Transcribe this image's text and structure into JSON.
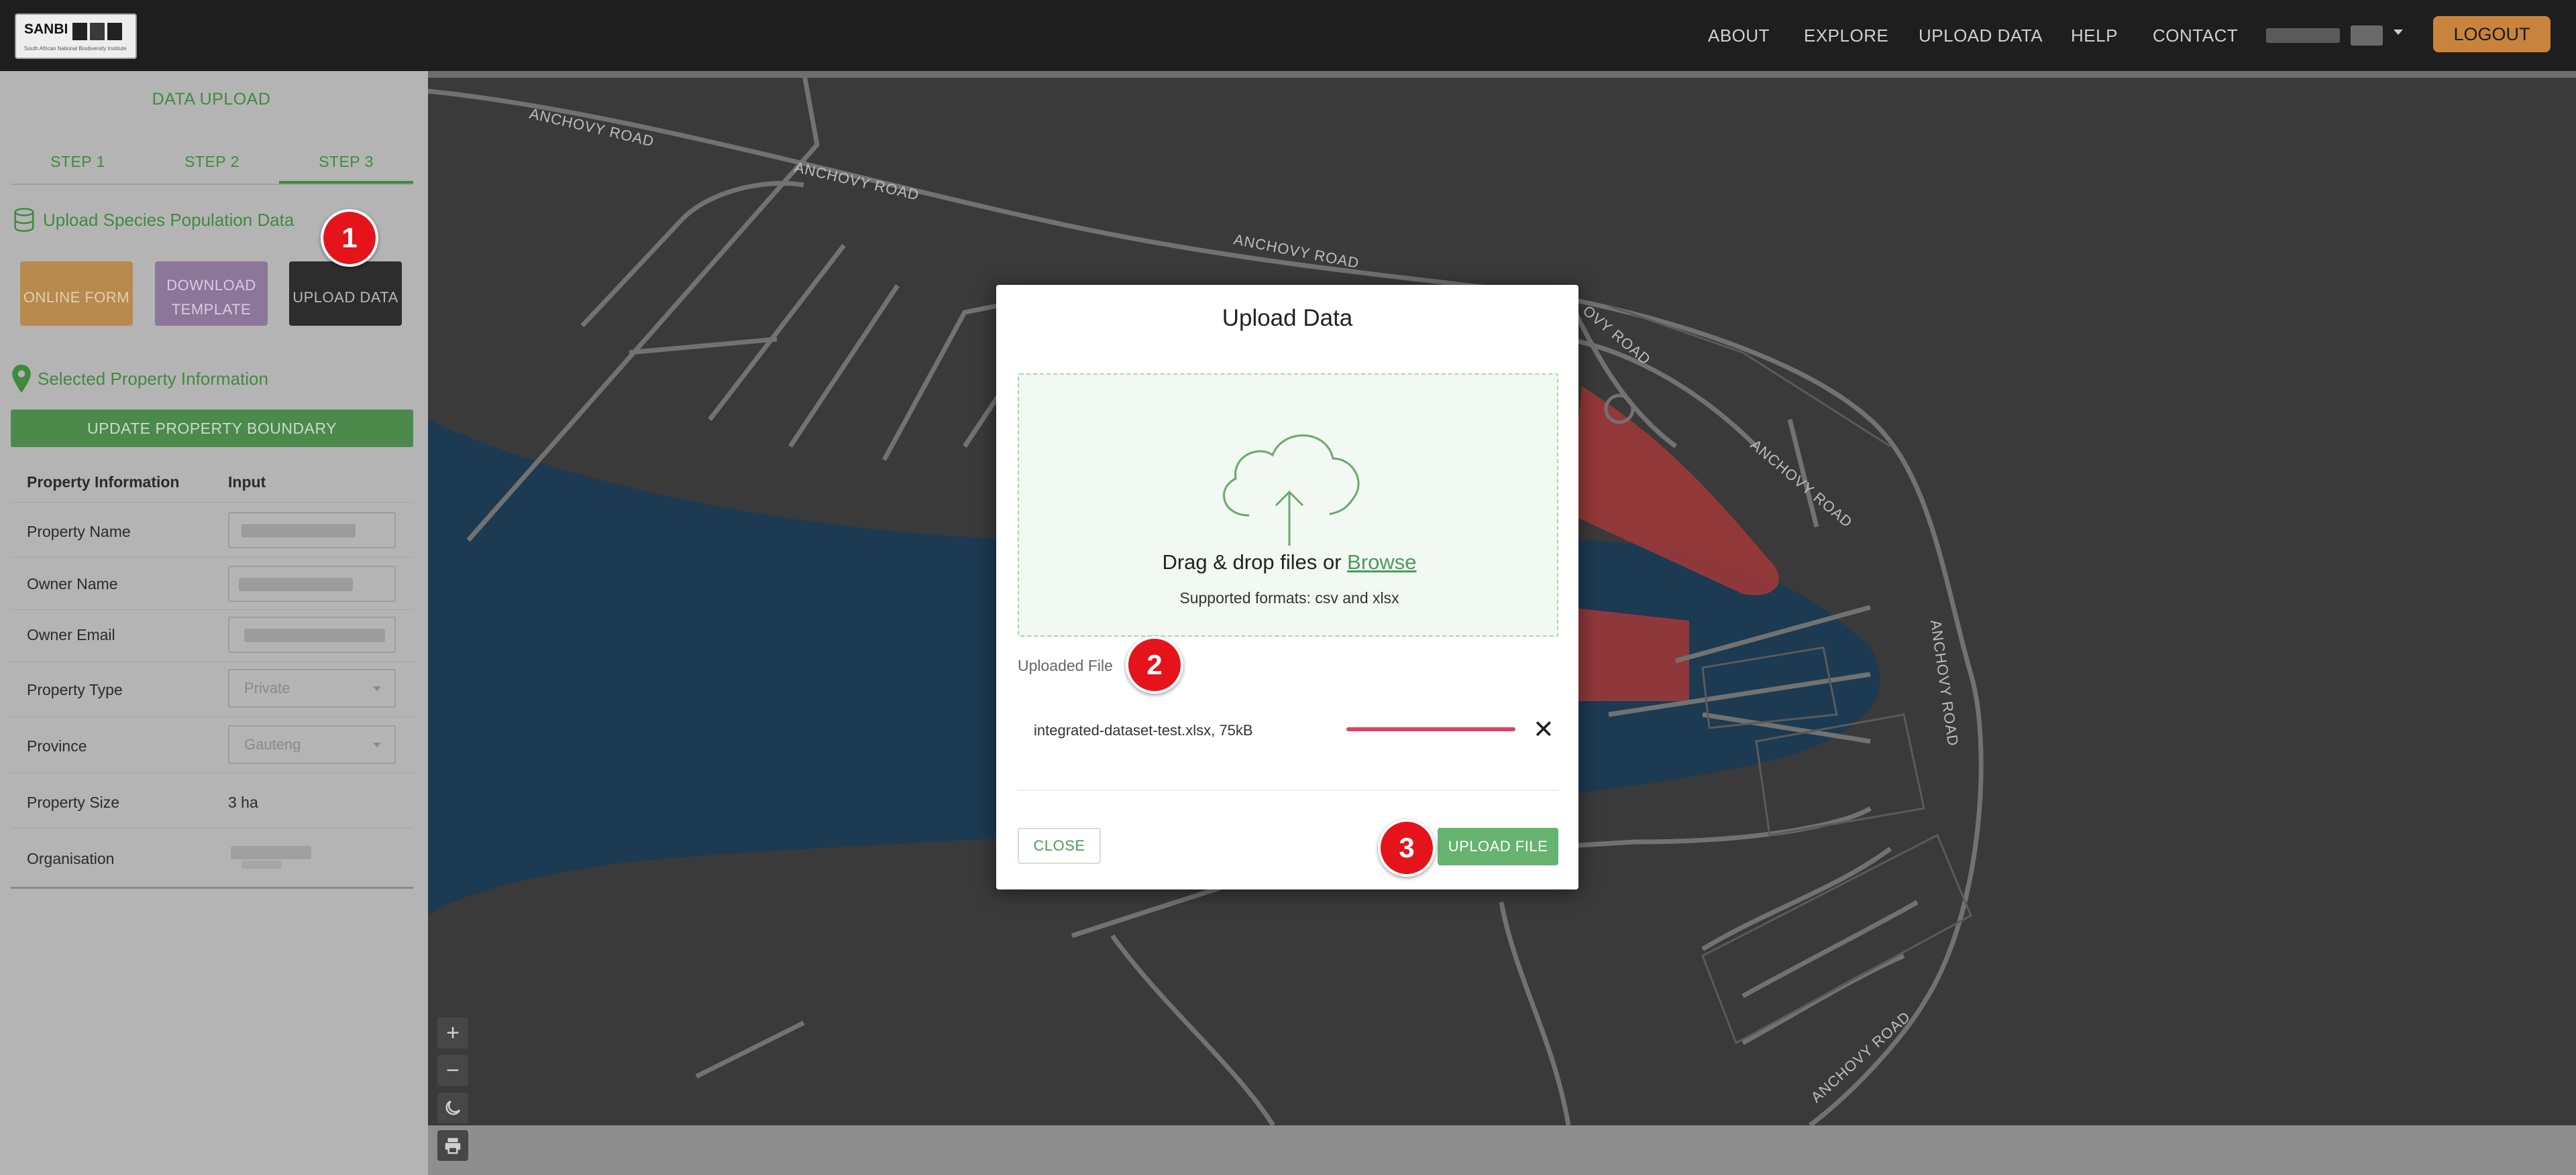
{
  "navbar": {
    "logo_text": "SANBI",
    "logo_subtitle": "South African National Biodiversity Institute",
    "items": [
      {
        "label": "ABOUT"
      },
      {
        "label": "EXPLORE"
      },
      {
        "label": "UPLOAD DATA"
      },
      {
        "label": "HELP"
      },
      {
        "label": "CONTACT"
      }
    ],
    "logout_label": "LOGOUT"
  },
  "sidebar": {
    "title": "DATA UPLOAD",
    "steps": [
      {
        "label": "STEP 1"
      },
      {
        "label": "STEP 2"
      },
      {
        "label": "STEP 3",
        "active": true
      }
    ],
    "upload_section_title": "Upload Species Population Data",
    "buttons": {
      "online_form": "ONLINE FORM",
      "download_template": "DOWNLOAD TEMPLATE",
      "upload_data": "UPLOAD DATA"
    },
    "property_section_title": "Selected Property Information",
    "update_boundary_label": "UPDATE PROPERTY BOUNDARY",
    "table": {
      "header_col1": "Property Information",
      "header_col2": "Input",
      "rows": {
        "property_name": "Property Name",
        "owner_name": "Owner Name",
        "owner_email": "Owner Email",
        "property_type": "Property Type",
        "property_type_value": "Private",
        "province": "Province",
        "province_value": "Gauteng",
        "property_size": "Property Size",
        "property_size_value": "3 ha",
        "organisation": "Organisation"
      }
    }
  },
  "map": {
    "road_label": "ANCHOVY ROAD",
    "road_label_partial": "OVY ROAD",
    "controls": {
      "zoom_in": "+",
      "zoom_out": "−"
    },
    "colors": {
      "water": "#1c3a52",
      "land": "#3a3a3a",
      "road": "#6a6a6a",
      "selected_parcel": "#b03a3a"
    }
  },
  "modal": {
    "title": "Upload Data",
    "dropzone_text": "Drag & drop files or ",
    "browse_label": "Browse",
    "supported_formats": "Supported formats: csv and xlsx",
    "uploaded_file_label": "Uploaded File",
    "file_name": "integrated-dataset-test.xlsx, 75kB",
    "remove_icon": "✕",
    "close_label": "CLOSE",
    "upload_label": "UPLOAD FILE"
  },
  "markers": [
    "1",
    "2",
    "3"
  ],
  "colors": {
    "accent_green": "#4c9a5c",
    "logout_orange": "#c8843c",
    "marker_red": "#e5141b",
    "progress_red": "#e04060"
  }
}
